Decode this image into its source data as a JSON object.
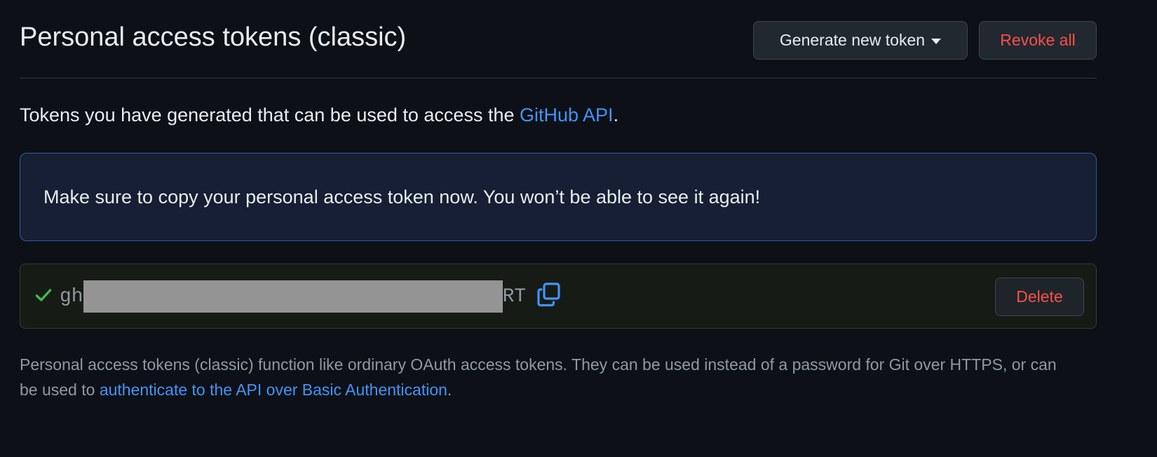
{
  "header": {
    "title": "Personal access tokens (classic)",
    "generate_label": "Generate new token",
    "revoke_label": "Revoke all"
  },
  "intro": {
    "text": "Tokens you have generated that can be used to access the ",
    "link": "GitHub API",
    "suffix": "."
  },
  "flash": {
    "message": "Make sure to copy your personal access token now. You won’t be able to see it again!"
  },
  "token": {
    "prefix": "gh",
    "suffix": "RT",
    "delete_label": "Delete"
  },
  "footnote": {
    "text": "Personal access tokens (classic) function like ordinary OAuth access tokens. They can be used instead of a password for Git over HTTPS, or can be used to ",
    "link": "authenticate to the API over Basic Authentication",
    "suffix": "."
  },
  "colors": {
    "background": "#0d1117",
    "link": "#4493f8",
    "danger": "#f85149",
    "success": "#3fb950",
    "flash_border": "#2f5aa6"
  },
  "icons": {
    "check": "check-icon",
    "copy": "copy-icon",
    "caret": "caret-down-icon"
  }
}
